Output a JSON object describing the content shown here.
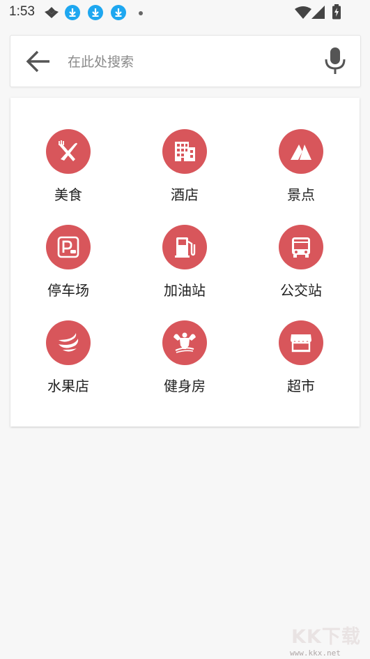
{
  "status": {
    "time": "1:53",
    "icons": [
      "app-notification-icon",
      "download-icon",
      "download-icon",
      "download-icon",
      "dot-icon",
      "wifi-icon",
      "signal-icon",
      "battery-charging-icon"
    ]
  },
  "search": {
    "placeholder": "在此处搜索",
    "back_icon": "arrow-left-icon",
    "mic_icon": "mic-icon"
  },
  "accent_color": "#d8565b",
  "categories": [
    {
      "label": "美食",
      "icon": "fork-knife-icon"
    },
    {
      "label": "酒店",
      "icon": "building-icon"
    },
    {
      "label": "景点",
      "icon": "mountain-icon"
    },
    {
      "label": "停车场",
      "icon": "parking-icon"
    },
    {
      "label": "加油站",
      "icon": "gas-pump-icon"
    },
    {
      "label": "公交站",
      "icon": "bus-icon"
    },
    {
      "label": "水果店",
      "icon": "banana-icon"
    },
    {
      "label": "健身房",
      "icon": "fitness-icon"
    },
    {
      "label": "超市",
      "icon": "store-icon"
    }
  ],
  "watermark": {
    "text": "KK下载",
    "url": "www.kkx.net"
  }
}
